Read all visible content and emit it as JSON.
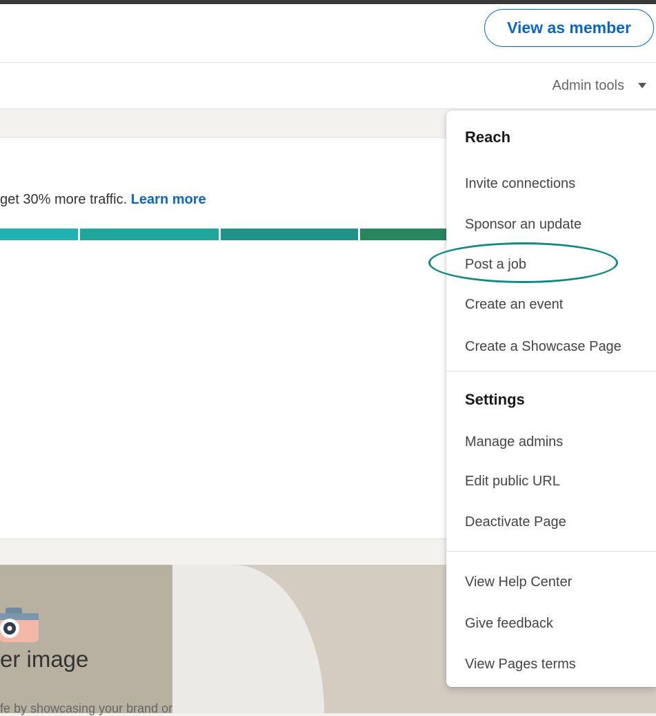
{
  "header": {
    "view_as_member_label": "View as member"
  },
  "subheader": {
    "admin_tools_label": "Admin tools",
    "caret_icon": "caret-down-icon"
  },
  "card": {
    "message_prefix": "get 30% more traffic. ",
    "learn_more_label": "Learn more",
    "progress_colors": [
      "#20b1b1",
      "#1ea79c",
      "#209287",
      "#28875f"
    ]
  },
  "cover": {
    "title": "er image",
    "subtitle": "fe by showcasing your brand or a social cause",
    "camera_icon": "camera-icon"
  },
  "menu": {
    "reach": {
      "heading": "Reach",
      "items": [
        "Invite connections",
        "Sponsor an update",
        "Post a job",
        "Create an event",
        "Create a Showcase Page"
      ]
    },
    "settings": {
      "heading": "Settings",
      "items": [
        "Manage admins",
        "Edit public URL",
        "Deactivate Page"
      ]
    },
    "help": {
      "items": [
        "View Help Center",
        "Give feedback",
        "View Pages terms"
      ]
    }
  },
  "colors": {
    "accent": "#0a66c2",
    "highlight_ring": "#0f8a82"
  }
}
